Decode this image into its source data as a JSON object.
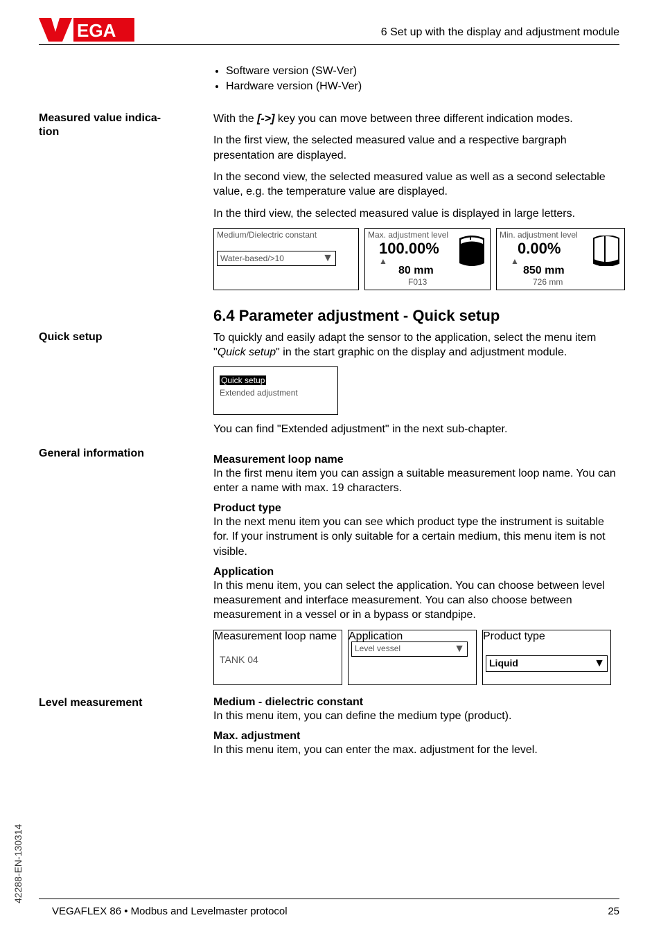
{
  "top_right": "6 Set up with the display and adjustment module",
  "bullets": {
    "b1": "Software version (SW-Ver)",
    "b2": "Hardware version (HW-Ver)"
  },
  "left_labels": {
    "mvi1": "Measured value indica-",
    "mvi2": "tion",
    "quick_setup": "Quick setup",
    "general_info": "General information",
    "level_meas": "Level measurement"
  },
  "key_label": "[->]",
  "p1a": "With the ",
  "p1b": " key you can move between three different indication modes.",
  "p2": "In the first view, the selected measured value and a respective bargraph presentation are displayed.",
  "p3": "In the second view, the selected measured value as well as a second selectable value, e.g. the temperature value are displayed.",
  "p4": "In the third view, the selected measured value is displayed in large letters.",
  "lcd": {
    "box1_title": "Medium/Dielectric constant",
    "box1_value": "Water-based/>10",
    "box2_title": "Max. adjustment level",
    "box2_value": "100.00%",
    "box2_mm": "80 mm",
    "box2_code": "F013",
    "box3_title": "Min. adjustment level",
    "box3_value": "0.00%",
    "box3_mm": "850 mm",
    "box3_code": "726 mm"
  },
  "section_label": "6.4   Parameter adjustment - Quick setup",
  "quicksetup_label": "Quick setup",
  "p5a": "To quickly and easily adapt the sensor to the application, select the menu item \"",
  "p5b": "\" in the start graphic on the display and adjustment module.",
  "menu": {
    "sel": "Quick setup",
    "unsel": "Extended adjustment"
  },
  "p6": "You can find \"Extended adjustment\" in the next sub-chapter.",
  "sub1": "Measurement loop name",
  "p7": "In the first menu item you can assign a suitable measurement loop name. You can enter a name with max. 19 characters.",
  "sub2": "Product type",
  "p8": "In the next menu item you can see which product type the instrument is suitable for. If your instrument is only suitable for a certain medium, this menu item is not visible.",
  "sub3": "Application",
  "p9": "In this menu item, you can select the application. You can choose between level measurement and interface measurement. You can also choose between measurement in a vessel or in a bypass or standpipe.",
  "lcd2": {
    "box4_title": "Measurement loop name",
    "box4_value": "TANK 04",
    "box5_title": "Application",
    "box5_value": "Level vessel",
    "box6_title": "Product type",
    "box6_value": "Liquid"
  },
  "sub4": "Medium - dielectric constant",
  "p10": "In this menu item, you can define the medium type (product).",
  "sub5": "Max. adjustment",
  "p11": "In this menu item, you can enter the max. adjustment for the level.",
  "rot": "42288-EN-130314",
  "footer_left": "VEGAFLEX 86 • Modbus and Levelmaster protocol",
  "footer_right": "25"
}
